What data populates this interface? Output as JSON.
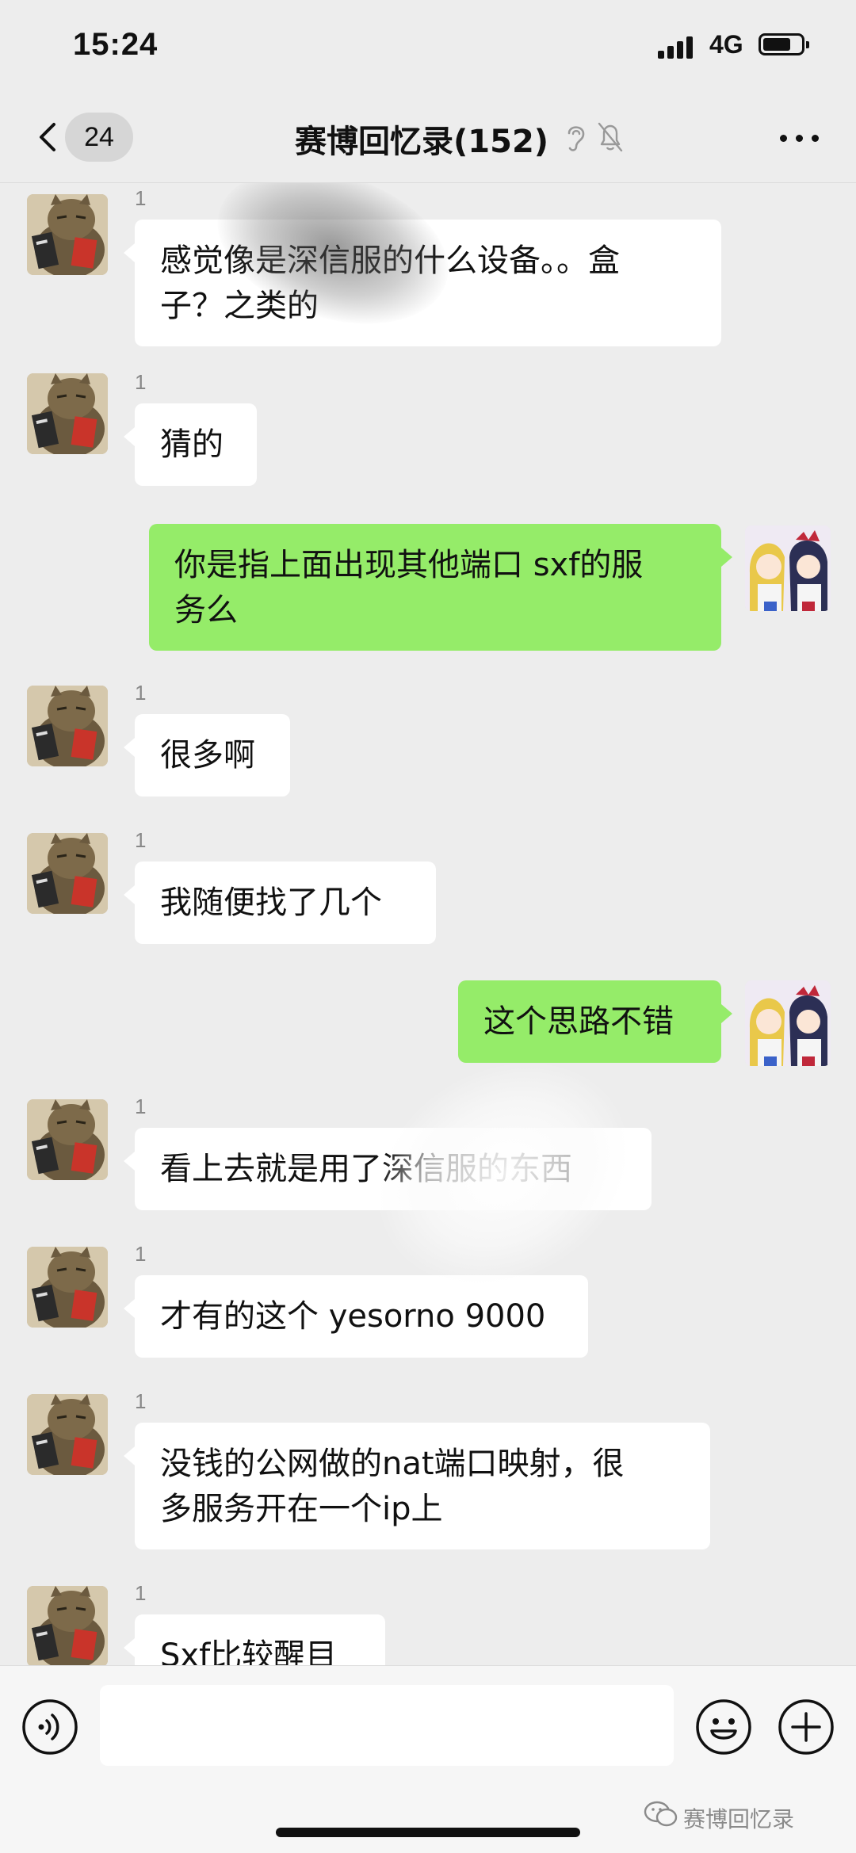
{
  "status_bar": {
    "time": "15:24",
    "network": "4G"
  },
  "nav": {
    "unread_count": "24",
    "title": "赛博回忆录(152)"
  },
  "messages": [
    {
      "direction": "in",
      "sender": "1",
      "lines": [
        "感觉像是深信服的什么设备。。盒",
        "子？之类的"
      ]
    },
    {
      "direction": "in",
      "sender": "1",
      "lines": [
        "猜的"
      ]
    },
    {
      "direction": "out",
      "lines": [
        "你是指上面出现其他端口 sxf的服",
        "务么"
      ]
    },
    {
      "direction": "in",
      "sender": "1",
      "lines": [
        "很多啊"
      ]
    },
    {
      "direction": "in",
      "sender": "1",
      "lines": [
        "我随便找了几个"
      ]
    },
    {
      "direction": "out",
      "lines": [
        "这个思路不错"
      ]
    },
    {
      "direction": "in",
      "sender": "1",
      "lines": [
        "看上去就是用了深信服的东西"
      ]
    },
    {
      "direction": "in",
      "sender": "1",
      "lines": [
        "才有的这个 yesorno 9000"
      ]
    },
    {
      "direction": "in",
      "sender": "1",
      "lines": [
        "没钱的公网做的nat端口映射，很",
        "多服务开在一个ip上"
      ]
    },
    {
      "direction": "in",
      "sender": "1",
      "lines": [
        "Sxf比较醒目"
      ]
    }
  ],
  "input": {
    "placeholder": ""
  },
  "watermark": "赛博回忆录",
  "colors": {
    "background": "#ededed",
    "incoming_bubble": "#ffffff",
    "outgoing_bubble": "#95ec69"
  }
}
